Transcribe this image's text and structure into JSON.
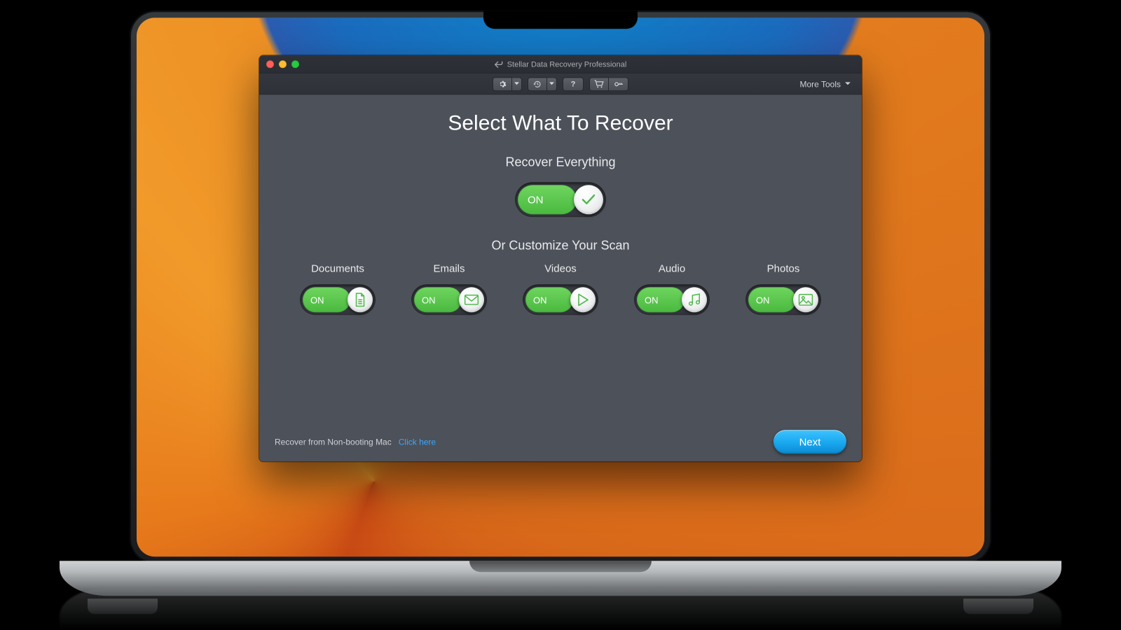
{
  "window": {
    "title": "Stellar Data Recovery Professional"
  },
  "toolbar": {
    "more_tools": "More Tools"
  },
  "main": {
    "heading": "Select What To Recover",
    "everything_label": "Recover Everything",
    "customize_label": "Or Customize Your Scan",
    "master_toggle": {
      "state": "ON"
    },
    "categories": [
      {
        "label": "Documents",
        "state": "ON",
        "icon": "document-icon"
      },
      {
        "label": "Emails",
        "state": "ON",
        "icon": "mail-icon"
      },
      {
        "label": "Videos",
        "state": "ON",
        "icon": "play-icon"
      },
      {
        "label": "Audio",
        "state": "ON",
        "icon": "music-icon"
      },
      {
        "label": "Photos",
        "state": "ON",
        "icon": "image-icon"
      }
    ]
  },
  "footer": {
    "nonboot_label": "Recover from Non-booting Mac",
    "nonboot_link": "Click here",
    "next": "Next"
  },
  "colors": {
    "accent_green": "#4db748",
    "accent_blue": "#18a7ef",
    "toggle_on": "#55c24a",
    "app_bg": "#4d515a"
  }
}
